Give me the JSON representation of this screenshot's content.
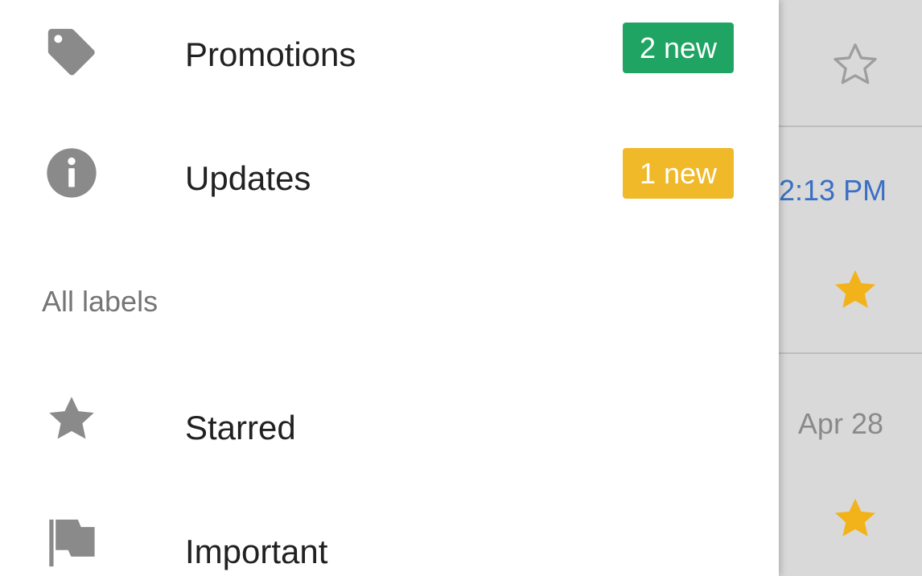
{
  "drawer": {
    "categories": [
      {
        "label": "Promotions",
        "icon": "tag-icon",
        "badge": "2 new",
        "badge_color": "#1fa463"
      },
      {
        "label": "Updates",
        "icon": "info-icon",
        "badge": "1 new",
        "badge_color": "#f0b92a"
      }
    ],
    "section_header": "All labels",
    "labels": [
      {
        "label": "Starred",
        "icon": "star-icon"
      },
      {
        "label": "Important",
        "icon": "important-flag-icon"
      }
    ],
    "icon_color": "#8a8a8a"
  },
  "inbox_background": {
    "rows": [
      {
        "time": "",
        "starred": false
      },
      {
        "time": "2:13 PM",
        "unread": true,
        "starred": true
      },
      {
        "time": "Apr 28",
        "unread": false,
        "starred": true
      }
    ],
    "star_color": "#f2b31a"
  }
}
